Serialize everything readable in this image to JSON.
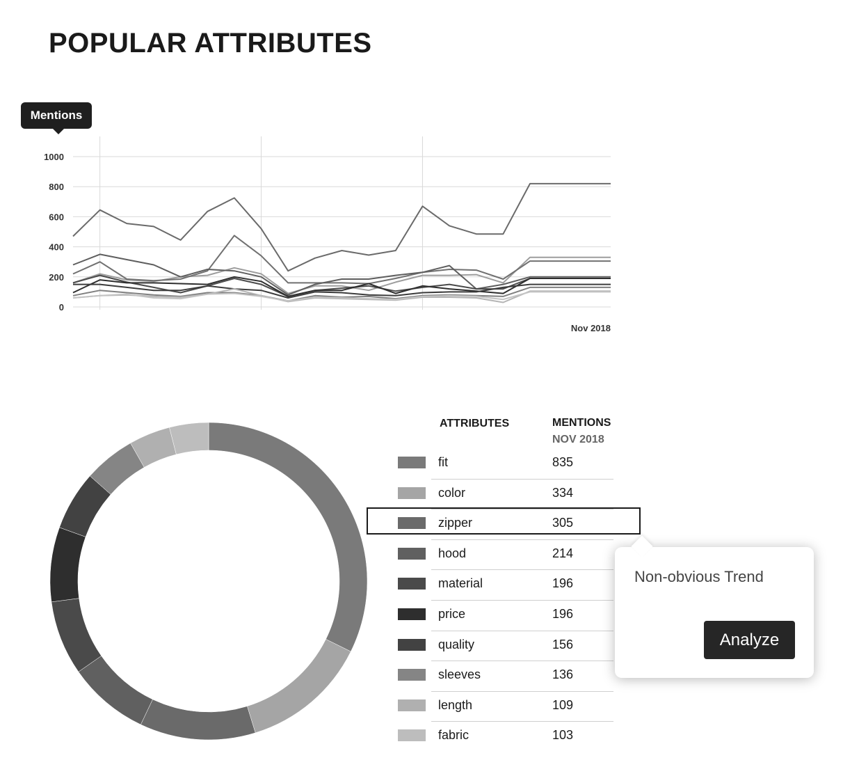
{
  "page": {
    "title": "POPULAR ATTRIBUTES"
  },
  "chart_data": [
    {
      "type": "line",
      "ylabel": "Mentions",
      "ylim": [
        0,
        1000
      ],
      "yticks": [
        0,
        200,
        400,
        600,
        800,
        1000
      ],
      "x_end_label": "Nov 2018",
      "x": [
        0,
        1,
        2,
        3,
        4,
        5,
        6,
        7,
        8,
        9,
        10,
        11,
        12,
        13,
        14,
        15,
        16,
        17,
        18,
        19,
        20
      ],
      "grid": true,
      "series": [
        {
          "name": "fit",
          "color": "#6a6a6a",
          "values": [
            470,
            645,
            555,
            535,
            445,
            635,
            725,
            520,
            240,
            325,
            375,
            345,
            375,
            670,
            540,
            485,
            485,
            820,
            820,
            820,
            820
          ]
        },
        {
          "name": "color",
          "color": "#9d9d9d",
          "values": [
            160,
            220,
            180,
            170,
            200,
            210,
            260,
            220,
            90,
            140,
            140,
            110,
            165,
            210,
            210,
            215,
            160,
            330,
            330,
            330,
            330
          ]
        },
        {
          "name": "zipper",
          "color": "#707070",
          "values": [
            220,
            300,
            185,
            175,
            185,
            240,
            475,
            340,
            160,
            160,
            160,
            155,
            190,
            230,
            250,
            245,
            185,
            305,
            305,
            305,
            305
          ]
        },
        {
          "name": "hood",
          "color": "#5e5e5e",
          "values": [
            280,
            350,
            315,
            280,
            200,
            250,
            240,
            200,
            80,
            150,
            185,
            185,
            210,
            230,
            275,
            120,
            150,
            200,
            200,
            200,
            200
          ]
        },
        {
          "name": "material",
          "color": "#4a4a4a",
          "values": [
            160,
            210,
            165,
            130,
            95,
            140,
            190,
            150,
            70,
            110,
            125,
            140,
            105,
            130,
            150,
            120,
            120,
            190,
            190,
            190,
            190
          ]
        },
        {
          "name": "price",
          "color": "#2e2e2e",
          "values": [
            95,
            180,
            160,
            160,
            155,
            150,
            200,
            170,
            70,
            110,
            110,
            155,
            90,
            140,
            120,
            105,
            90,
            190,
            190,
            190,
            190
          ]
        },
        {
          "name": "quality",
          "color": "#3c3c3c",
          "values": [
            150,
            150,
            130,
            110,
            110,
            140,
            120,
            110,
            60,
            100,
            95,
            80,
            75,
            95,
            100,
            100,
            130,
            150,
            150,
            150,
            150
          ]
        },
        {
          "name": "sleeves",
          "color": "#808080",
          "values": [
            75,
            110,
            95,
            80,
            70,
            95,
            95,
            75,
            40,
            75,
            65,
            70,
            55,
            75,
            80,
            75,
            70,
            130,
            130,
            130,
            130
          ]
        },
        {
          "name": "length",
          "color": "#b5b5b5",
          "values": [
            60,
            75,
            80,
            70,
            65,
            85,
            120,
            75,
            35,
            60,
            55,
            50,
            45,
            65,
            65,
            60,
            30,
            105,
            105,
            105,
            105
          ]
        },
        {
          "name": "fabric",
          "color": "#c4c4c4",
          "values": [
            60,
            75,
            85,
            60,
            55,
            85,
            90,
            70,
            40,
            65,
            60,
            55,
            50,
            70,
            75,
            70,
            50,
            100,
            100,
            100,
            100
          ]
        }
      ]
    },
    {
      "type": "pie",
      "categories": [
        "fit",
        "color",
        "zipper",
        "hood",
        "material",
        "price",
        "quality",
        "sleeves",
        "length",
        "fabric"
      ],
      "values": [
        835,
        334,
        305,
        214,
        196,
        196,
        156,
        136,
        109,
        103
      ],
      "colors": [
        "#7a7a7a",
        "#a5a5a5",
        "#6a6a6a",
        "#606060",
        "#4a4a4a",
        "#2e2e2e",
        "#424242",
        "#858585",
        "#b0b0b0",
        "#bdbdbd"
      ],
      "donut": true
    }
  ],
  "legend": {
    "col_attributes": "ATTRIBUTES",
    "col_mentions": "MENTIONS",
    "col_period": "NOV 2018",
    "rows": [
      {
        "name": "fit",
        "value": "835",
        "color": "#7a7a7a"
      },
      {
        "name": "color",
        "value": "334",
        "color": "#a5a5a5"
      },
      {
        "name": "zipper",
        "value": "305",
        "color": "#6a6a6a"
      },
      {
        "name": "hood",
        "value": "214",
        "color": "#606060"
      },
      {
        "name": "material",
        "value": "196",
        "color": "#4a4a4a"
      },
      {
        "name": "price",
        "value": "196",
        "color": "#2e2e2e"
      },
      {
        "name": "quality",
        "value": "156",
        "color": "#424242"
      },
      {
        "name": "sleeves",
        "value": "136",
        "color": "#858585"
      },
      {
        "name": "length",
        "value": "109",
        "color": "#b0b0b0"
      },
      {
        "name": "fabric",
        "value": "103",
        "color": "#bdbdbd"
      }
    ]
  },
  "selection": {
    "row": "zipper"
  },
  "popover": {
    "text": "Non-obvious Trend",
    "button": "Analyze"
  }
}
